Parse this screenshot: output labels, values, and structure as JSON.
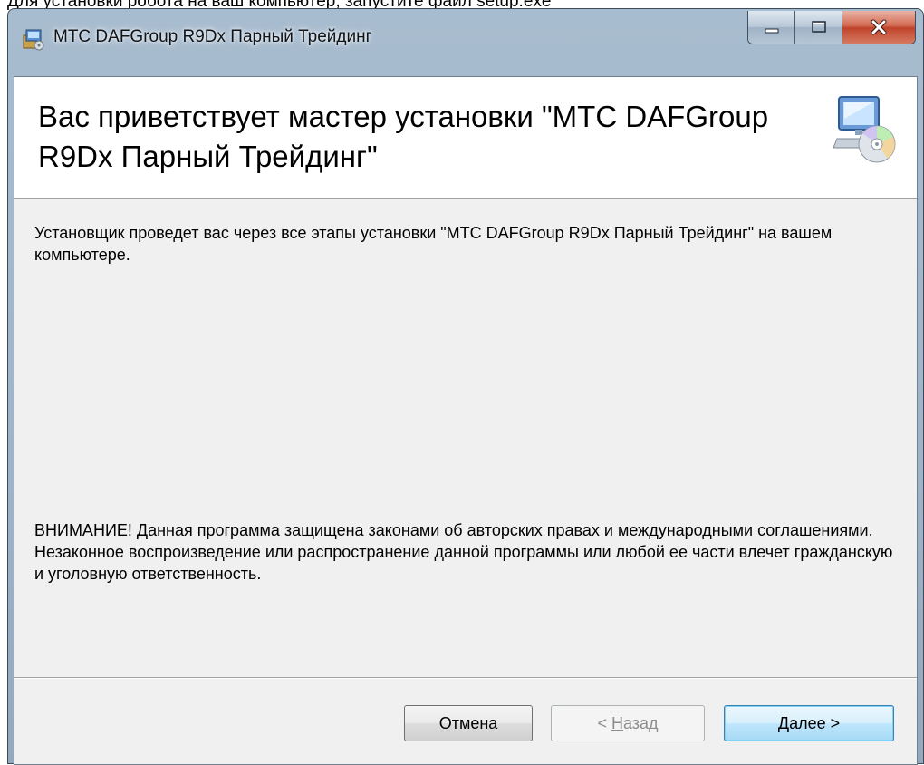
{
  "page": {
    "caption": "Для установки робота на ваш компьютер, запустите файл setup.exe"
  },
  "window": {
    "title": "МТС DAFGroup R9Dx Парный Трейдинг",
    "icons": {
      "app": "installer-package-icon",
      "minimize": "minimize-icon",
      "maximize": "maximize-icon",
      "close": "close-icon",
      "banner": "computer-cd-icon"
    }
  },
  "banner": {
    "title": "Вас приветствует мастер установки \"МТС DAFGroup R9Dx Парный Трейдинг\""
  },
  "content": {
    "intro": "Установщик проведет вас через все этапы установки \"МТС DAFGroup R9Dx Парный Трейдинг\" на вашем компьютере.",
    "warning": "ВНИМАНИЕ! Данная программа защищена законами об авторских правах и международными соглашениями. Незаконное воспроизведение или распространение данной программы или любой ее части влечет гражданскую и уголовную ответственность."
  },
  "buttons": {
    "cancel": "Отмена",
    "back_prefix": "< ",
    "back_key": "Н",
    "back_rest": "азад",
    "next_key": "Д",
    "next_rest": "алее >"
  },
  "colors": {
    "title_bar": "#a8bccf",
    "close_button": "#c0432b",
    "default_button_border": "#3c7fb1",
    "dialog_bg": "#f0f0f0"
  }
}
